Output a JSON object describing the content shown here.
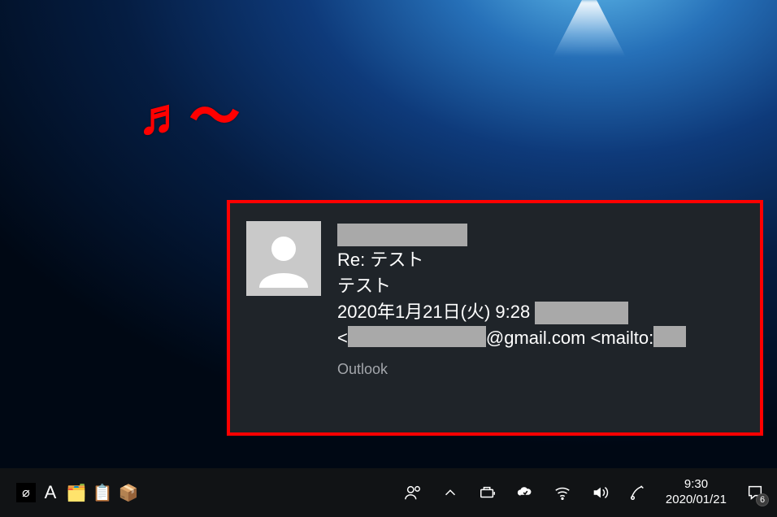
{
  "annotation": {
    "music": "♬～"
  },
  "notification": {
    "subject": "Re: テスト",
    "body": "テスト",
    "timestamp": "2020年1月21日(火) 9:28 ",
    "email_suffix": "@gmail.com <mailto:",
    "app": "Outlook"
  },
  "taskbar": {
    "ime_mode": "A",
    "clock_time": "9:30",
    "clock_date": "2020/01/21",
    "badge": "6"
  }
}
